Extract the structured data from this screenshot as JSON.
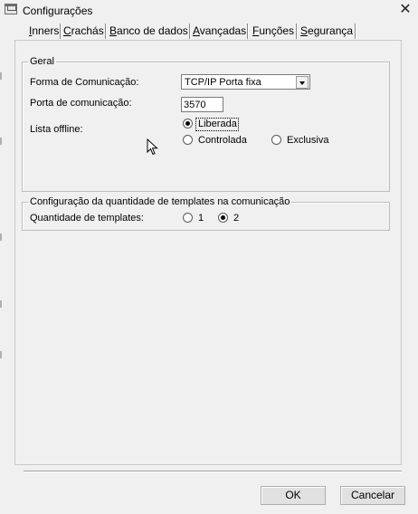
{
  "window": {
    "title": "Configurações"
  },
  "tabs": [
    {
      "label": "Inners",
      "selected": true
    },
    {
      "label": "Crachás",
      "selected": false
    },
    {
      "label": "Banco de dados",
      "selected": false
    },
    {
      "label": "Avançadas",
      "selected": false
    },
    {
      "label": "Funções",
      "selected": false
    },
    {
      "label": "Segurança",
      "selected": false
    }
  ],
  "geral": {
    "legend": "Geral",
    "forma_label": "Forma de Comunicação:",
    "forma_value": "TCP/IP Porta fixa",
    "porta_label": "Porta de comunicação:",
    "porta_value": "3570",
    "lista_label": "Lista offline:",
    "lista_options": [
      {
        "label": "Liberada",
        "selected": true
      },
      {
        "label": "Controlada",
        "selected": false
      },
      {
        "label": "Exclusiva",
        "selected": false
      }
    ]
  },
  "templates": {
    "legend": "Configuração da quantidade de templates na comunicação",
    "qtd_label": "Quantidade de templates:",
    "options": [
      {
        "label": "1",
        "selected": false
      },
      {
        "label": "2",
        "selected": true
      }
    ]
  },
  "buttons": {
    "ok": "OK",
    "cancel": "Cancelar"
  }
}
